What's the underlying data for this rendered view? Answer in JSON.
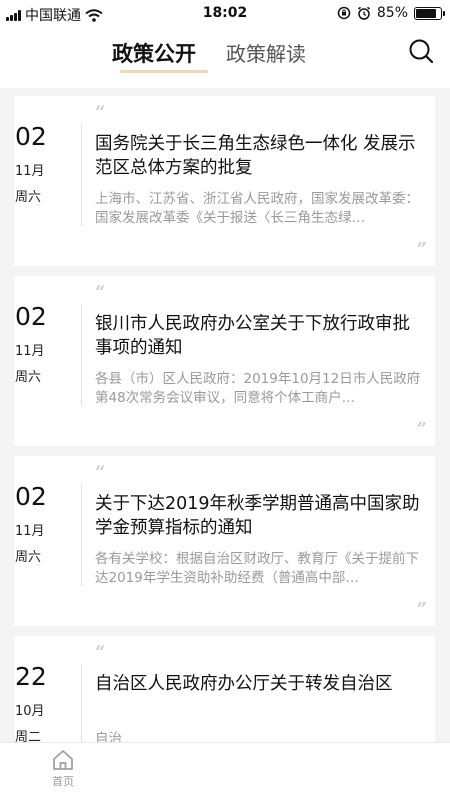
{
  "status_bar": {
    "carrier": "中国联通",
    "time": "18:02",
    "battery": "85%",
    "battery_level": 0.85
  },
  "nav": {
    "tabs": [
      {
        "label": "政策公开",
        "active": true
      },
      {
        "label": "政策解读",
        "active": false
      }
    ],
    "search_icon": "search-icon"
  },
  "articles": [
    {
      "day": "02",
      "month": "11月",
      "weekday": "周六",
      "title": "国务院关于长三角生态绿色一体化  发展示范区总体方案的批复",
      "summary": "上海市、江苏省、浙江省人民政府，国家发展改革委：国家发展改革委《关于报送〈长三角生态绿…"
    },
    {
      "day": "02",
      "month": "11月",
      "weekday": "周六",
      "title": "银川市人民政府办公室关于下放行政审批事项的通知",
      "summary": "各县（市）区人民政府：2019年10月12日市人民政府第48次常务会议审议，同意将个体工商户…"
    },
    {
      "day": "02",
      "month": "11月",
      "weekday": "周六",
      "title": "关于下达2019年秋季学期普通高中国家助学金预算指标的通知",
      "summary": "各有关学校：根据自治区财政厅、教育厅《关于提前下达2019年学生资助补助经费（普通高中部…"
    },
    {
      "day": "22",
      "month": "10月",
      "weekday": "周二",
      "title": "自治区人民政府办公厅关于转发自治区",
      "summary": "自治"
    }
  ],
  "bottom_nav": {
    "items": [
      {
        "label": "首页",
        "icon": "home-icon"
      }
    ]
  },
  "colors": {
    "accent_underline": "#f2d9b4",
    "quote_mark": "#cfcfcf",
    "summary_text": "#9a9a9a",
    "background": "#f4f4f4"
  }
}
